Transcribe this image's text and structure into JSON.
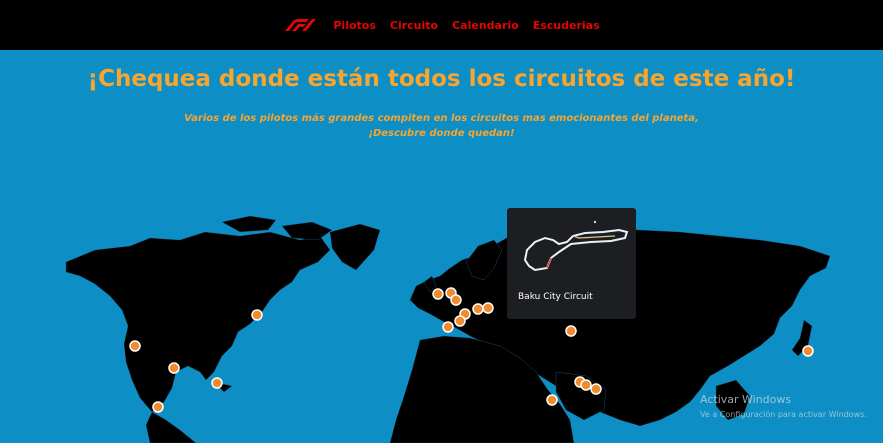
{
  "nav": {
    "items": [
      {
        "label": "Pilotos"
      },
      {
        "label": "Circuito"
      },
      {
        "label": "Calendario"
      },
      {
        "label": "Escuderias"
      }
    ]
  },
  "hero": {
    "title": "¡Chequea donde están todos los circuitos de este año!",
    "subtitle_line1": "Varios de los pilotos más grandes compiten en los circuitos mas emocionantes del planeta,",
    "subtitle_line2": "¡Descubre donde quedan!"
  },
  "tooltip": {
    "circuit_name": "Baku City Circuit"
  },
  "watermark": {
    "title": "Activar Windows",
    "subtitle": "Ve a Configuración para activar Windows."
  },
  "colors": {
    "ocean": "#0d8fc6",
    "land": "#000000",
    "accent": "#f7a531",
    "nav_link": "#e10600",
    "marker": "#f28a2e"
  }
}
